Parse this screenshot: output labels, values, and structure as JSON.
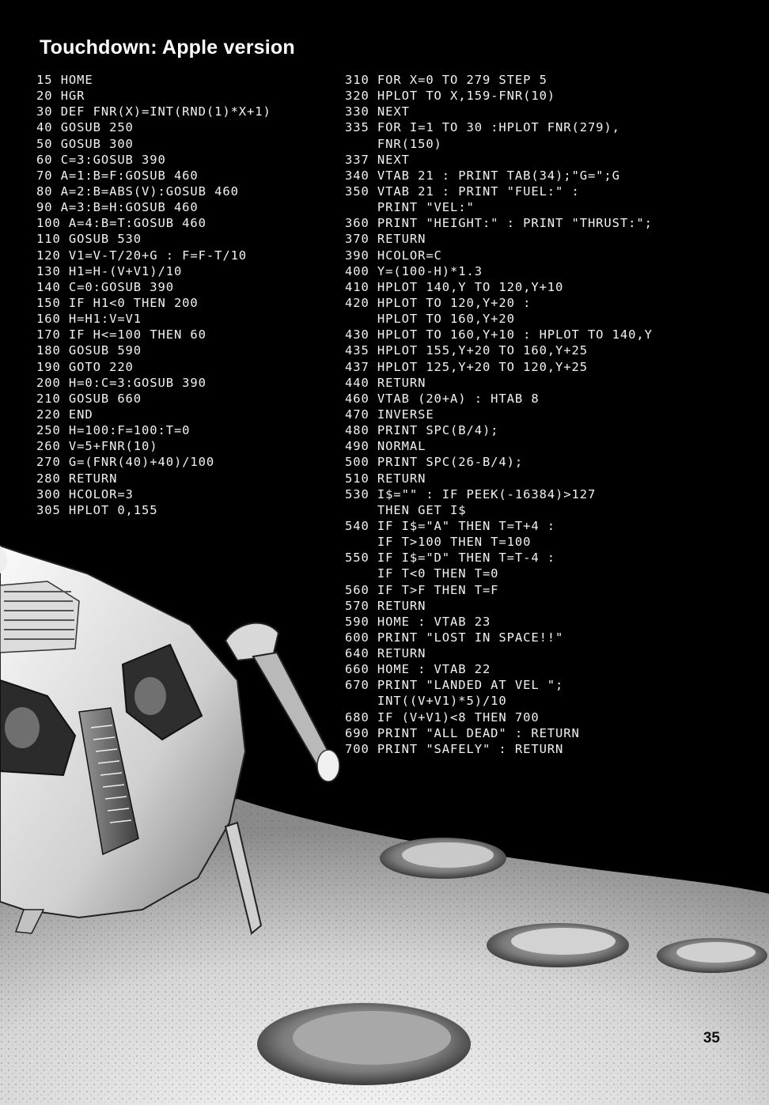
{
  "title": "Touchdown: Apple version",
  "page_number": "35",
  "listing_left": [
    "15 HOME",
    "20 HGR",
    "30 DEF FNR(X)=INT(RND(1)*X+1)",
    "40 GOSUB 250",
    "50 GOSUB 300",
    "60 C=3:GOSUB 390",
    "70 A=1:B=F:GOSUB 460",
    "80 A=2:B=ABS(V):GOSUB 460",
    "90 A=3:B=H:GOSUB 460",
    "100 A=4:B=T:GOSUB 460",
    "110 GOSUB 530",
    "120 V1=V-T/20+G : F=F-T/10",
    "130 H1=H-(V+V1)/10",
    "140 C=0:GOSUB 390",
    "150 IF H1<0 THEN 200",
    "160 H=H1:V=V1",
    "170 IF H<=100 THEN 60",
    "180 GOSUB 590",
    "190 GOTO 220",
    "200 H=0:C=3:GOSUB 390",
    "210 GOSUB 660",
    "220 END",
    "250 H=100:F=100:T=0",
    "260 V=5+FNR(10)",
    "270 G=(FNR(40)+40)/100",
    "280 RETURN",
    "300 HCOLOR=3",
    "305 HPLOT 0,155"
  ],
  "listing_right": [
    "310 FOR X=0 TO 279 STEP 5",
    "320 HPLOT TO X,159-FNR(10)",
    "330 NEXT",
    "335 FOR I=1 TO 30 :HPLOT FNR(279),",
    "    FNR(150)",
    "337 NEXT",
    "340 VTAB 21 : PRINT TAB(34);\"G=\";G",
    "350 VTAB 21 : PRINT \"FUEL:\" :",
    "    PRINT \"VEL:\"",
    "360 PRINT \"HEIGHT:\" : PRINT \"THRUST:\";",
    "370 RETURN",
    "390 HCOLOR=C",
    "400 Y=(100-H)*1.3",
    "410 HPLOT 140,Y TO 120,Y+10",
    "420 HPLOT TO 120,Y+20 :",
    "    HPLOT TO 160,Y+20",
    "430 HPLOT TO 160,Y+10 : HPLOT TO 140,Y",
    "435 HPLOT 155,Y+20 TO 160,Y+25",
    "437 HPLOT 125,Y+20 TO 120,Y+25",
    "440 RETURN",
    "460 VTAB (20+A) : HTAB 8",
    "470 INVERSE",
    "480 PRINT SPC(B/4);",
    "490 NORMAL",
    "500 PRINT SPC(26-B/4);",
    "510 RETURN",
    "530 I$=\"\" : IF PEEK(-16384)>127",
    "    THEN GET I$",
    "540 IF I$=\"A\" THEN T=T+4 :",
    "    IF T>100 THEN T=100",
    "550 IF I$=\"D\" THEN T=T-4 :",
    "    IF T<0 THEN T=0",
    "560 IF T>F THEN T=F",
    "570 RETURN",
    "590 HOME : VTAB 23",
    "600 PRINT \"LOST IN SPACE!!\"",
    "640 RETURN",
    "660 HOME : VTAB 22",
    "670 PRINT \"LANDED AT VEL \";",
    "    INT((V+V1)*5)/10",
    "680 IF (V+V1)<8 THEN 700",
    "690 PRINT \"ALL DEAD\" : RETURN",
    "700 PRINT \"SAFELY\" : RETURN"
  ]
}
